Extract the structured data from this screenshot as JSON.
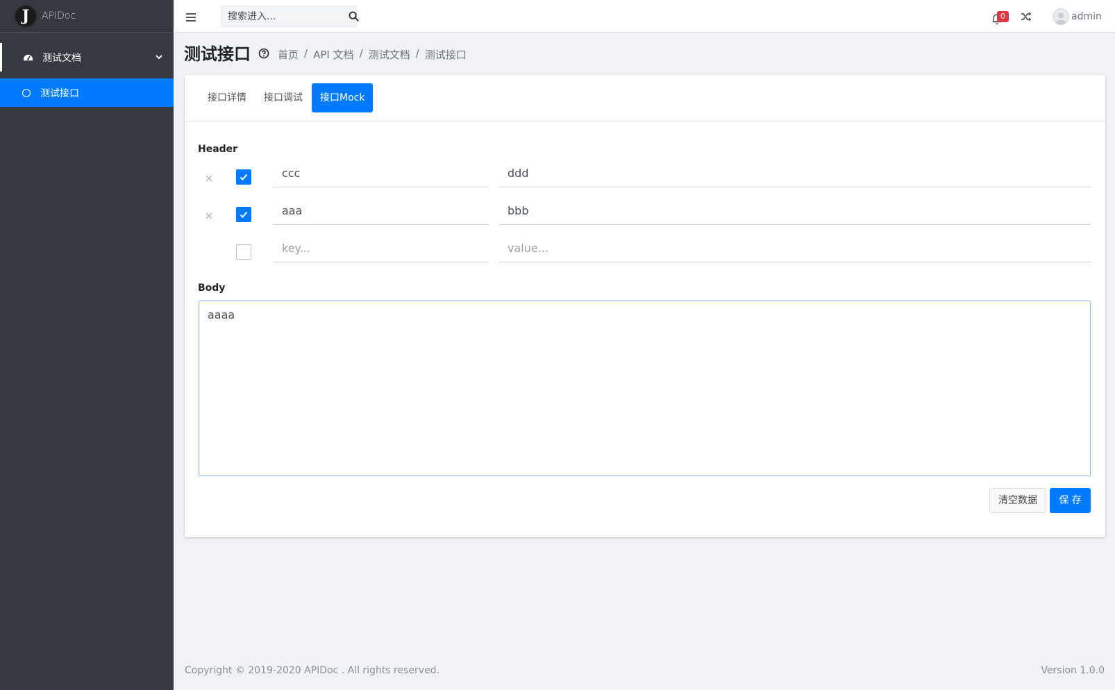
{
  "brand": {
    "logo_letter": "J",
    "name": "APIDoc"
  },
  "sidebar": {
    "group": {
      "label": "测试文档",
      "icon": "tachometer-icon"
    },
    "items": [
      {
        "label": "测试接口",
        "active": true,
        "icon": "circle-icon"
      }
    ]
  },
  "topbar": {
    "search_placeholder": "搜索进入...",
    "notification_count": "0",
    "user_name": "admin"
  },
  "page": {
    "title": "测试接口",
    "breadcrumb": [
      "首页",
      "API 文档",
      "测试文档",
      "测试接口"
    ]
  },
  "tabs": [
    {
      "label": "接口详情",
      "active": false
    },
    {
      "label": "接口调试",
      "active": false
    },
    {
      "label": "接口Mock",
      "active": true
    }
  ],
  "header_section": {
    "label": "Header",
    "rows": [
      {
        "enabled": true,
        "key": "ccc",
        "value": "ddd"
      },
      {
        "enabled": true,
        "key": "aaa",
        "value": "bbb"
      },
      {
        "enabled": false,
        "key": "",
        "value": "",
        "key_placeholder": "key...",
        "value_placeholder": "value..."
      }
    ]
  },
  "body_section": {
    "label": "Body",
    "value": "aaaa"
  },
  "actions": {
    "clear_label": "清空数据",
    "save_label": "保 存"
  },
  "footer": {
    "copyright": "Copyright © 2019-2020 APIDoc . All rights reserved.",
    "version": "Version 1.0.0"
  },
  "colors": {
    "accent": "#007bff",
    "sidebar_bg": "#343a40",
    "badge": "#dc3545"
  }
}
